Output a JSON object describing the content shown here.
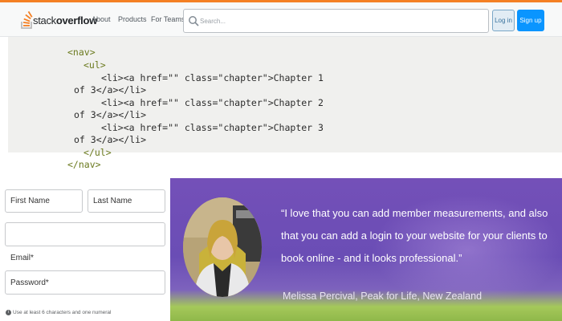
{
  "header": {
    "logo_prefix": "stack",
    "logo_suffix": "overflow",
    "nav": [
      "About",
      "Products",
      "For Teams"
    ],
    "search_placeholder": "Search...",
    "login_label": "Log in",
    "signup_label": "Sign up",
    "accent_color": "#f48024",
    "signup_color": "#0a95ff"
  },
  "code": {
    "language": "html",
    "lines": [
      "<nav>",
      "<ul>",
      "<li><a href=\"\" class=\"chapter\">Chapter 1",
      "of 3</a></li>",
      "<li><a href=\"\" class=\"chapter\">Chapter 2",
      "of 3</a></li>",
      "<li><a href=\"\" class=\"chapter\">Chapter 3",
      "of 3</a></li>",
      "</ul>",
      "</nav>"
    ]
  },
  "form": {
    "first_name_placeholder": "First Name",
    "last_name_placeholder": "Last Name",
    "email_label": "Email*",
    "email_value": "",
    "password_placeholder": "Password*",
    "hint_text": "Use at least 6 characters and one numeral",
    "hint_icon": "info-icon"
  },
  "testimonial": {
    "quote": "“I love that you can add member measurements, and also that you can add a login to your website for your clients to book online - and it looks professional.”",
    "author": "Melissa Percival, Peak for Life, New Zealand",
    "background_color": "#7450b8"
  }
}
